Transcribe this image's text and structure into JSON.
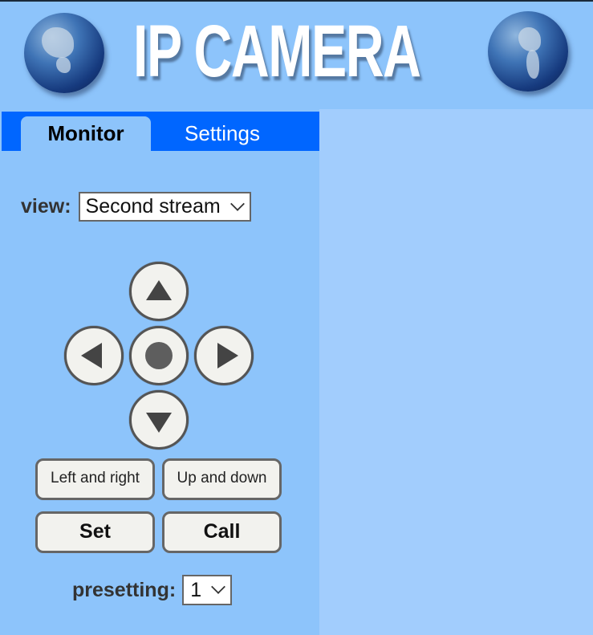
{
  "banner": {
    "title": "IP CAMERA",
    "left_icon": "globe-north-america-icon",
    "right_icon": "globe-south-america-icon"
  },
  "tabs": [
    {
      "label": "Monitor",
      "active": true
    },
    {
      "label": "Settings",
      "active": false
    }
  ],
  "view": {
    "label": "view:",
    "selected": "Second stream"
  },
  "ptz": {
    "up_icon": "arrow-up-icon",
    "left_icon": "arrow-left-icon",
    "center_icon": "center-stop-icon",
    "right_icon": "arrow-right-icon",
    "down_icon": "arrow-down-icon"
  },
  "buttons": {
    "left_and_right": "Left and right",
    "up_and_down": "Up and down",
    "set": "Set",
    "call": "Call"
  },
  "presetting": {
    "label": "presetting:",
    "selected": "1"
  },
  "colors": {
    "tab_bar": "#0066ff",
    "panel": "#8dc4fb",
    "right_panel": "#a2cdfd"
  }
}
